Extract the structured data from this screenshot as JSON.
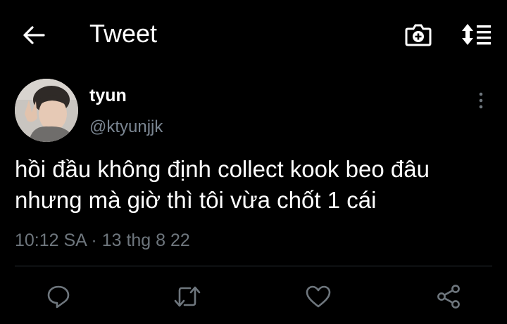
{
  "header": {
    "title": "Tweet",
    "back_icon": "arrow-left-icon",
    "camera_icon": "camera-add-icon",
    "sort_icon": "sort-list-icon"
  },
  "tweet": {
    "author_name": "tyun",
    "author_handle": "@ktyunjjk",
    "text_lines": [
      "hồi đầu không định collect kook beo đâu",
      "nhưng mà giờ thì tôi vừa chốt 1 cái"
    ],
    "timestamp": "10:12 SA · 13 thg 8 22"
  },
  "actions": [
    {
      "icon": "reply-icon"
    },
    {
      "icon": "retweet-icon"
    },
    {
      "icon": "like-icon"
    },
    {
      "icon": "share-icon"
    }
  ],
  "colors": {
    "background": "#000000",
    "text_primary": "#ffffff",
    "text_secondary": "#6e767d",
    "icon": "#6e767d",
    "divider": "#2b3036"
  }
}
